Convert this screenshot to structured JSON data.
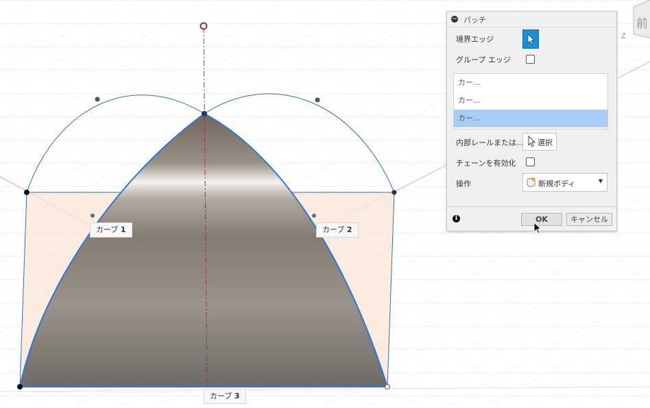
{
  "viewport": {
    "curve_labels": [
      {
        "prefix": "カーブ",
        "num": "1"
      },
      {
        "prefix": "カーブ",
        "num": "2"
      },
      {
        "prefix": "カーブ",
        "num": "3"
      }
    ],
    "viewcube_face": "前",
    "axis_label": "Z"
  },
  "dialog": {
    "title": "パッチ",
    "rows": {
      "boundary_edges": "境界エッジ",
      "group_edges": "グループ エッジ",
      "interior_rails": "内部レールまたは...",
      "select_label": "選択",
      "enable_chains": "チェーンを有効化",
      "operation": "操作",
      "operation_value": "新規ボディ"
    },
    "selection_list": [
      "カー...",
      "カー...",
      "カー..."
    ],
    "buttons": {
      "ok": "OK",
      "cancel": "キャンセル"
    }
  },
  "colors": {
    "accent": "#1a8fd6",
    "list_selected": "#a9cdf6",
    "curve_blue": "#2f6fc0",
    "axis_red": "#d94a4a",
    "axis_magenta": "#8b2a5a",
    "fill_peach": "#fbe5d6"
  },
  "icons": [
    "collapse-icon",
    "cursor-icon",
    "new-body-icon",
    "dropdown-caret-icon",
    "info-icon"
  ]
}
